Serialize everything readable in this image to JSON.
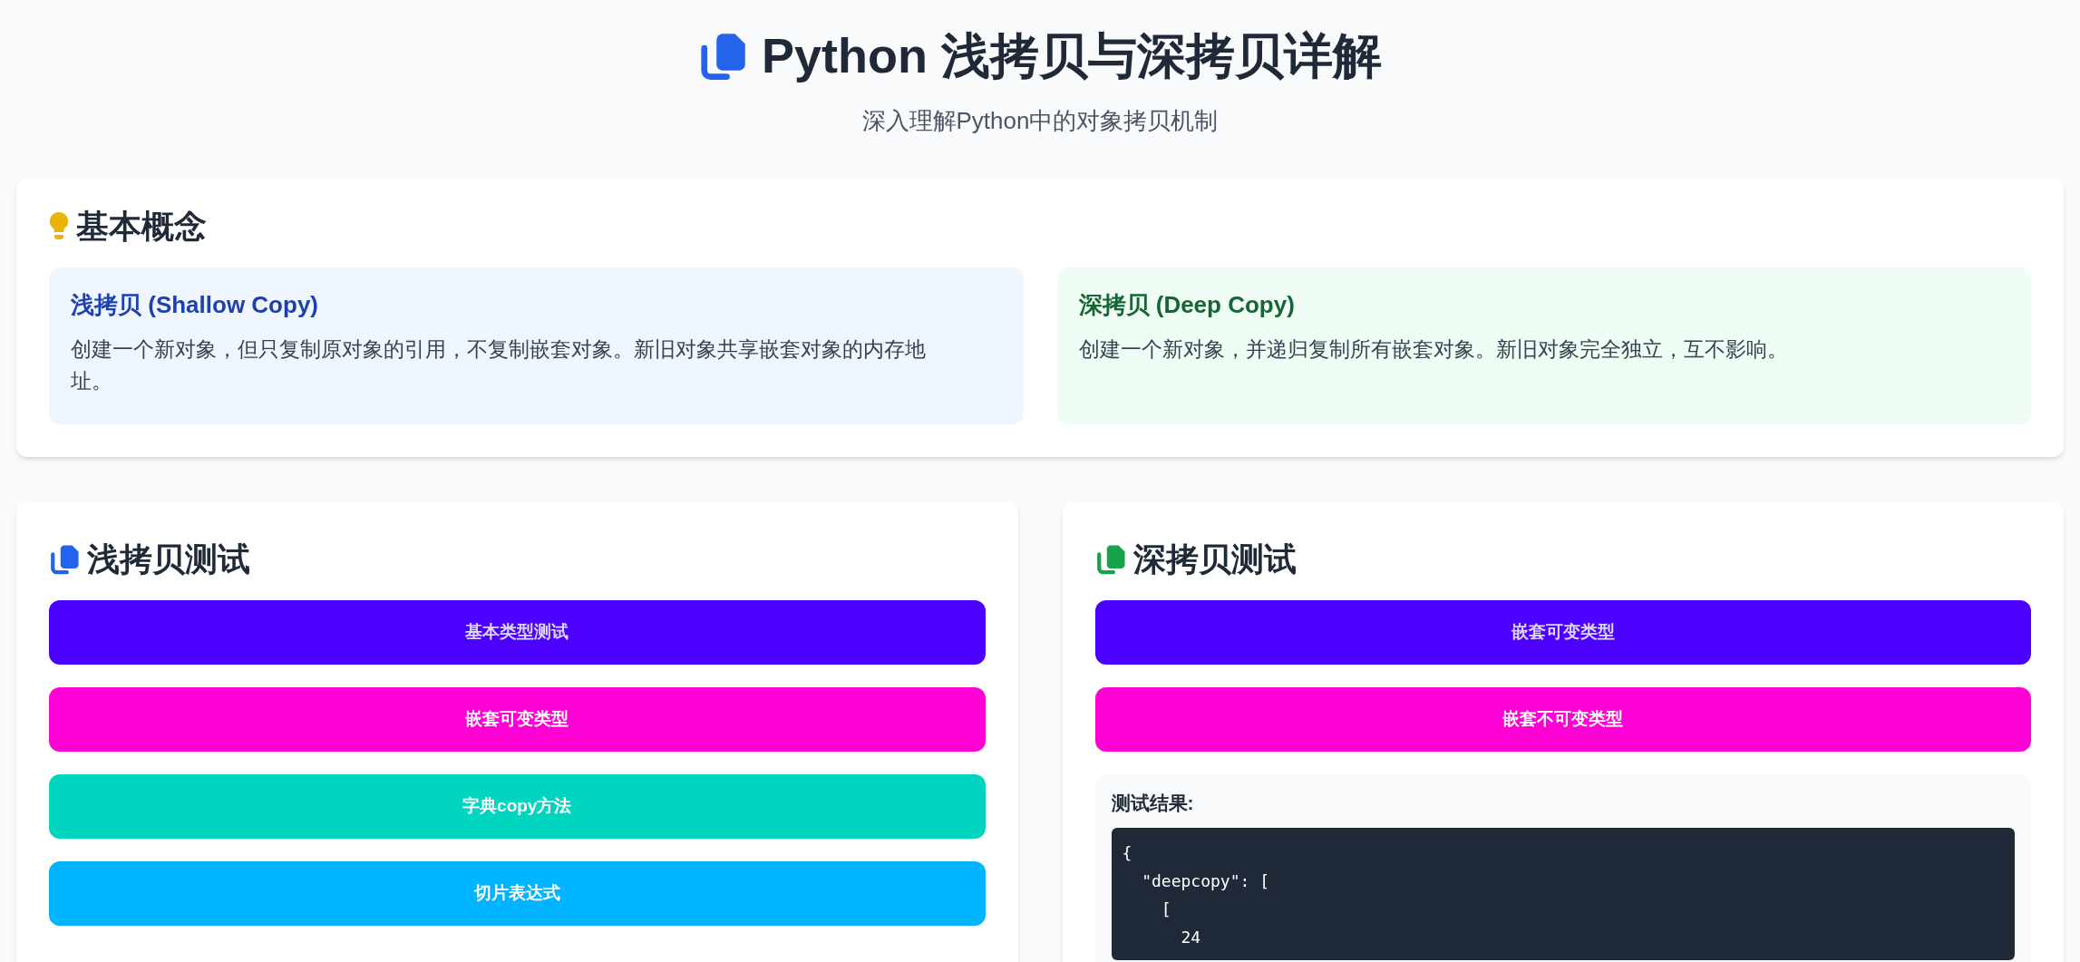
{
  "header": {
    "title": "Python 浅拷贝与深拷贝详解",
    "subtitle": "深入理解Python中的对象拷贝机制"
  },
  "concepts": {
    "title": "基本概念",
    "cards": [
      {
        "kind": "shallow",
        "title": "浅拷贝 (Shallow Copy)",
        "text": "创建一个新对象，但只复制原对象的引用，不复制嵌套对象。新旧对象共享嵌套对象的内存地址。"
      },
      {
        "kind": "deep",
        "title": "深拷贝 (Deep Copy)",
        "text": "创建一个新对象，并递归复制所有嵌套对象。新旧对象完全独立，互不影响。"
      }
    ]
  },
  "panels": [
    {
      "kind": "shallow",
      "title": "浅拷贝测试",
      "buttons": [
        {
          "label": "基本类型测试",
          "color": "#4c00ff"
        },
        {
          "label": "嵌套可变类型",
          "color": "#ff00d4"
        },
        {
          "label": "字典copy方法",
          "color": "#00d5c0"
        },
        {
          "label": "切片表达式",
          "color": "#00b4ff"
        }
      ]
    },
    {
      "kind": "deep",
      "title": "深拷贝测试",
      "buttons": [
        {
          "label": "嵌套可变类型",
          "color": "#4c00ff"
        },
        {
          "label": "嵌套不可变类型",
          "color": "#ff00d4"
        }
      ],
      "result": {
        "label": "测试结果:",
        "code": [
          "{",
          "  \"deepcopy\": [",
          "    [",
          "      24"
        ]
      }
    }
  ]
}
